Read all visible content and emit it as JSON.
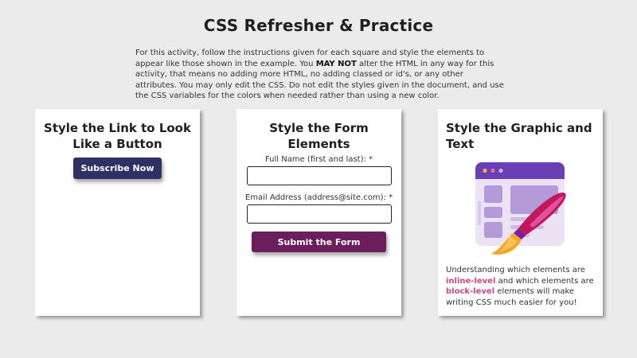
{
  "page": {
    "title": "CSS Refresher & Practice",
    "intro_part1": "For this activity, follow the instructions given for each square and style the elements to appear like those shown in the example. You ",
    "intro_bold": "MAY NOT",
    "intro_part2": " alter the HTML in any way for this activity, that means no adding more HTML, no adding classed or id's, or any other attributes. You may only edit the CSS. Do not edit the styles given in the document, and use the CSS variables for the colors when needed rather than using a new color."
  },
  "cards": {
    "link": {
      "title": "Style the Link to Look Like a Button",
      "button_label": "Subscribe Now"
    },
    "form": {
      "title": "Style the Form Elements",
      "name_label": "Full Name (first and last): *",
      "name_value": "",
      "email_label": "Email Address (address@site.com): *",
      "email_value": "",
      "submit_label": "Submit the Form"
    },
    "graphic": {
      "title": "Style the Graphic and Text",
      "image_icon": "browser-window-paintbrush-icon",
      "text_part1": "Understanding which elements are ",
      "inline_level": "inline-level",
      "text_part2": " and which elements are ",
      "block_level": "block-level",
      "text_part3": " elements will make writing CSS much easier for you!"
    }
  },
  "colors": {
    "background": "#ebebeb",
    "link_button": "#2e3163",
    "submit_button": "#6b1d5c",
    "highlight": "#d2467f",
    "browser_header": "#6a3fb6",
    "browser_body": "#ebe3f3",
    "browser_blocks": "#b49ad8",
    "brush_handle": "#c2185b",
    "brush_tip": "#f5a623"
  }
}
